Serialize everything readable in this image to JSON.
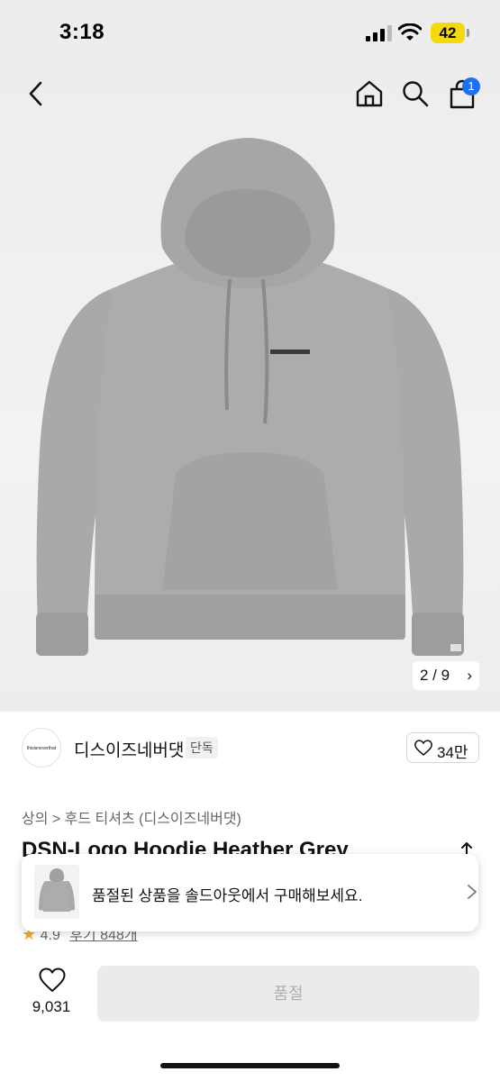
{
  "status_bar": {
    "time": "3:18",
    "battery": "42"
  },
  "cart": {
    "badge_count": "1"
  },
  "image_counter": {
    "text": "2 / 9",
    "chevron": "›"
  },
  "brand": {
    "logo_text": "thisisneverthat",
    "name": "디스이즈네버댓",
    "tag": "단독",
    "like_count": "34만"
  },
  "breadcrumb": "상의 > 후드 티셔츠 (디스이즈네버댓)",
  "product": {
    "title": "DSN-Logo Hoodie Heather Grey"
  },
  "rating": {
    "star": "★",
    "score": "4.9",
    "reviews": "후기 848개"
  },
  "toast": {
    "message": "품절된 상품을 솔드아웃에서 구매해보세요."
  },
  "bottom_bar": {
    "like_count": "9,031",
    "button_label": "품절"
  },
  "icons": {
    "back": "chevron-left-icon",
    "home": "home-icon",
    "search": "search-icon",
    "bag": "shopping-bag-icon",
    "heart": "heart-icon",
    "share": "share-icon"
  },
  "colors": {
    "badge_blue": "#1d6ff3",
    "battery_yellow": "#f5d90a",
    "star": "#f1a91c",
    "soldout_bg": "#ebebeb"
  }
}
